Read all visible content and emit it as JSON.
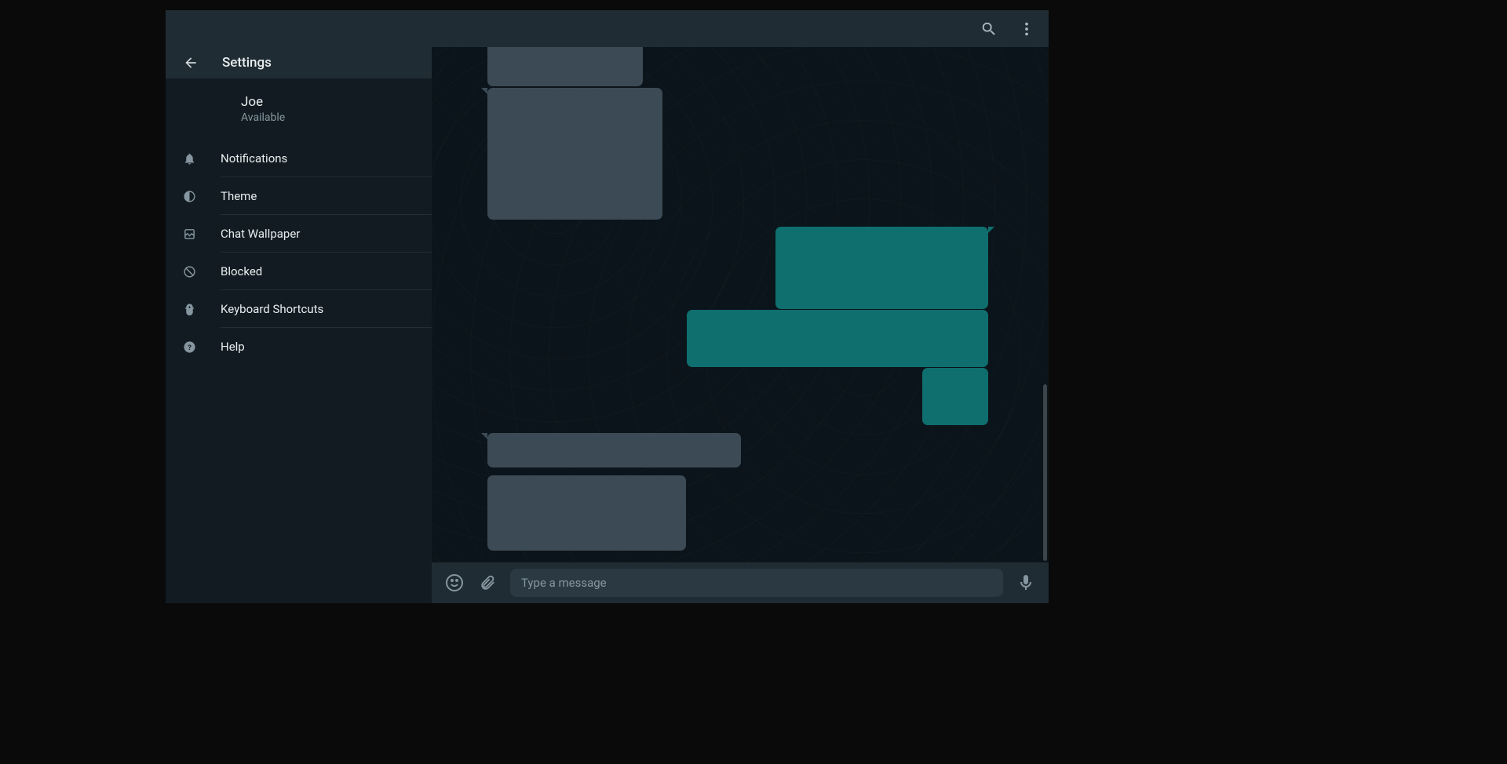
{
  "sidebar": {
    "title": "Settings",
    "profile": {
      "name": "Joe",
      "status": "Available"
    },
    "items": [
      {
        "label": "Notifications"
      },
      {
        "label": "Theme"
      },
      {
        "label": "Chat Wallpaper"
      },
      {
        "label": "Blocked"
      },
      {
        "label": "Keyboard Shortcuts"
      },
      {
        "label": "Help"
      }
    ]
  },
  "composer": {
    "placeholder": "Type a message"
  },
  "colors": {
    "incoming": "#3b4a54",
    "outgoing": "#0f6e6e",
    "panel": "#202c33",
    "bg": "#0b141a"
  }
}
